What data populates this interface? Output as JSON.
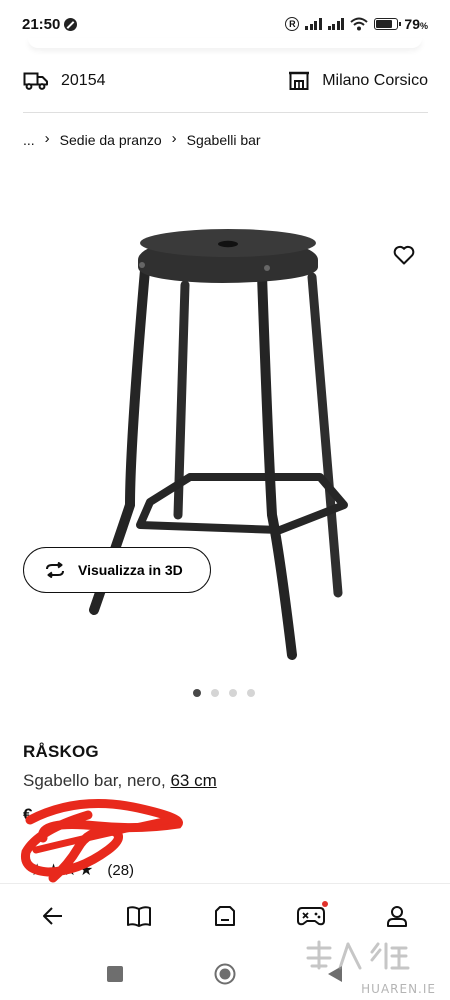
{
  "status_bar": {
    "time": "21:50",
    "battery": "79",
    "battery_unit": "%"
  },
  "delivery": {
    "postal_code": "20154",
    "store": "Milano Corsico"
  },
  "breadcrumb": {
    "ellipsis": "...",
    "items": [
      "Sedie da pranzo",
      "Sgabelli bar"
    ]
  },
  "product": {
    "view_3d_label": "Visualizza in 3D",
    "carousel_total": 4,
    "carousel_active": 1,
    "name": "RÅSKOG",
    "description": "Sgabello bar, nero, ",
    "size": "63 cm",
    "price": "€",
    "review_count": "(28)",
    "rating": 3.5
  },
  "bottom_nav": {
    "items": [
      "back-icon",
      "catalog-icon",
      "shopping-bag-icon",
      "gamepad-icon",
      "profile-icon"
    ]
  },
  "watermark": {
    "text": "HUAREN.IE"
  },
  "colors": {
    "text": "#111111",
    "dot_inactive": "#d5d5d5",
    "dot_active": "#484848",
    "scribble": "#e8291c",
    "notification": "#e0312b"
  }
}
